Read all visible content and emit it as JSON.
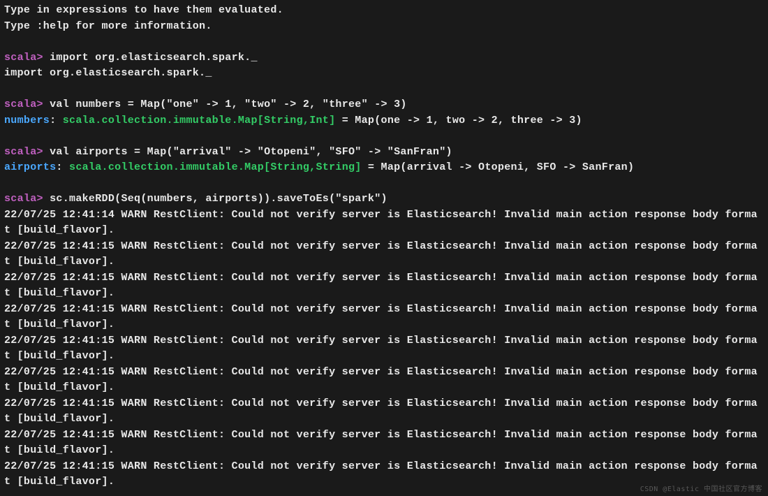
{
  "intro": {
    "line1": "Type in expressions to have them evaluated.",
    "line2": "Type :help for more information."
  },
  "prompt": "scala>",
  "blocks": [
    {
      "cmd": "import org.elasticsearch.spark._",
      "echo": "import org.elasticsearch.spark._"
    },
    {
      "cmd": "val numbers = Map(\"one\" -> 1, \"two\" -> 2, \"three\" -> 3)",
      "res_var": "numbers",
      "res_colon": ": ",
      "res_type": "scala.collection.immutable.Map[String,Int]",
      "res_rest": " = Map(one -> 1, two -> 2, three -> 3)"
    },
    {
      "cmd": "val airports = Map(\"arrival\" -> \"Otopeni\", \"SFO\" -> \"SanFran\")",
      "res_var": "airports",
      "res_colon": ": ",
      "res_type": "scala.collection.immutable.Map[String,String]",
      "res_rest": " = Map(arrival -> Otopeni, SFO -> SanFran)"
    },
    {
      "cmd": "sc.makeRDD(Seq(numbers, airports)).saveToEs(\"spark\")"
    }
  ],
  "warnings": [
    "22/07/25 12:41:14 WARN RestClient: Could not verify server is Elasticsearch! Invalid main action response body format [build_flavor].",
    "22/07/25 12:41:15 WARN RestClient: Could not verify server is Elasticsearch! Invalid main action response body format [build_flavor].",
    "22/07/25 12:41:15 WARN RestClient: Could not verify server is Elasticsearch! Invalid main action response body format [build_flavor].",
    "22/07/25 12:41:15 WARN RestClient: Could not verify server is Elasticsearch! Invalid main action response body format [build_flavor].",
    "22/07/25 12:41:15 WARN RestClient: Could not verify server is Elasticsearch! Invalid main action response body format [build_flavor].",
    "22/07/25 12:41:15 WARN RestClient: Could not verify server is Elasticsearch! Invalid main action response body format [build_flavor].",
    "22/07/25 12:41:15 WARN RestClient: Could not verify server is Elasticsearch! Invalid main action response body format [build_flavor].",
    "22/07/25 12:41:15 WARN RestClient: Could not verify server is Elasticsearch! Invalid main action response body format [build_flavor].",
    "22/07/25 12:41:15 WARN RestClient: Could not verify server is Elasticsearch! Invalid main action response body format [build_flavor]."
  ],
  "watermark": "CSDN @Elastic 中国社区官方博客"
}
